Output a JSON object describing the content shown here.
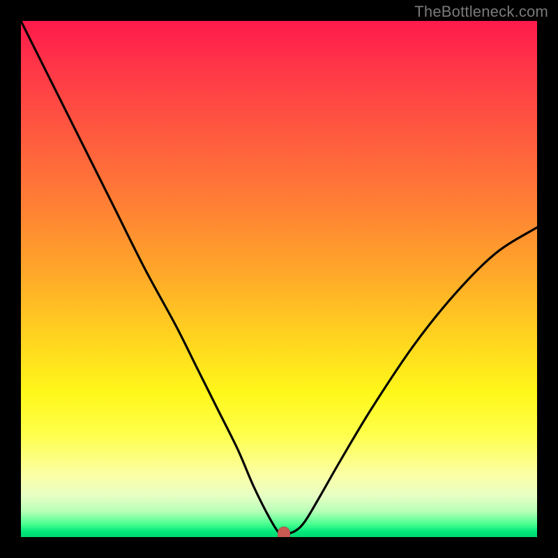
{
  "watermark": "TheBottleneck.com",
  "chart_data": {
    "type": "line",
    "title": "",
    "xlabel": "",
    "ylabel": "",
    "xlim": [
      0,
      100
    ],
    "ylim": [
      0,
      100
    ],
    "grid": false,
    "legend": false,
    "series": [
      {
        "name": "bottleneck-curve",
        "x": [
          0,
          6,
          12,
          18,
          24,
          30,
          34,
          38,
          42,
          45,
          48,
          50,
          51,
          53,
          55,
          58,
          62,
          68,
          76,
          84,
          92,
          100
        ],
        "values": [
          100,
          88,
          76,
          64,
          52,
          41,
          33,
          25,
          17,
          10,
          4,
          0.8,
          0.6,
          1.1,
          3,
          8,
          15,
          25,
          37,
          47,
          55,
          60
        ]
      }
    ],
    "marker": {
      "x": 51,
      "y": 0.6,
      "color": "#c95a52"
    },
    "background_gradient": {
      "type": "vertical",
      "stops": [
        {
          "pos": 0.0,
          "color": "#ff1a4b"
        },
        {
          "pos": 0.35,
          "color": "#ff7e35"
        },
        {
          "pos": 0.72,
          "color": "#fff71a"
        },
        {
          "pos": 0.95,
          "color": "#b8ffb8"
        },
        {
          "pos": 1.0,
          "color": "#00d873"
        }
      ]
    }
  }
}
